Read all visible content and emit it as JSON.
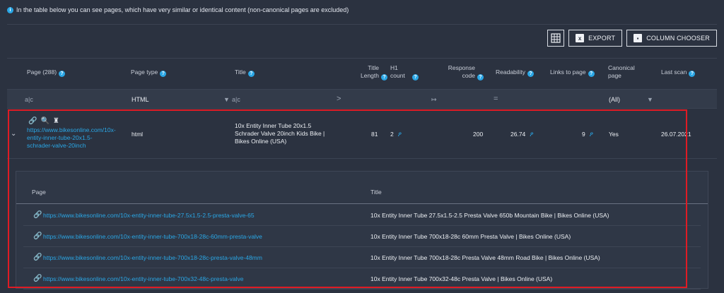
{
  "info": {
    "icon": "info-icon",
    "text": "In the table below you can see pages, which have very similar or identical content (non-canonical pages are excluded)"
  },
  "toolbar": {
    "grid_icon": "grid-settings-icon",
    "export_label": "EXPORT",
    "column_chooser_label": "COLUMN CHOOSER"
  },
  "columns": {
    "page": "Page (288)",
    "page_type": "Page type",
    "title": "Title",
    "title_length": "Title Length",
    "h1_count": "H1 count",
    "response_code": "Response code",
    "readability": "Readability",
    "links_to_page": "Links to page",
    "canonical": "Canonical page",
    "last_scan": "Last scan"
  },
  "filters": {
    "page": "a|c",
    "page_type": "HTML",
    "title": "a|c",
    "title_length": ">",
    "response_code": "↦",
    "readability": "=",
    "canonical": "(All)"
  },
  "row": {
    "url": "https://www.bikesonline.com/10x-entity-inner-tube-20x1.5-schrader-valve-20inch",
    "url_line1": "https://www.bikesonline.com/10x-",
    "url_line2": "entity-inner-tube-20x1.5-",
    "url_line3": "schrader-valve-20inch",
    "page_type": "html",
    "title_line1": "10x Entity Inner Tube 20x1.5",
    "title_line2": "Schrader Valve 20inch Kids Bike |",
    "title_line3": "Bikes Online (USA)",
    "title_length": "81",
    "h1_count": "2",
    "response_code": "200",
    "readability": "26.74",
    "links_to_page": "9",
    "canonical": "Yes",
    "last_scan": "26.07.2021"
  },
  "detail": {
    "col_page": "Page",
    "col_title": "Title",
    "rows": [
      {
        "page": "https://www.bikesonline.com/10x-entity-inner-tube-27.5x1.5-2.5-presta-valve-65",
        "title": "10x Entity Inner Tube 27.5x1.5-2.5 Presta Valve 650b Mountain Bike | Bikes Online (USA)"
      },
      {
        "page": "https://www.bikesonline.com/10x-entity-inner-tube-700x18-28c-60mm-presta-valve",
        "title": "10x Entity Inner Tube 700x18-28c 60mm Presta Valve | Bikes Online (USA)"
      },
      {
        "page": "https://www.bikesonline.com/10x-entity-inner-tube-700x18-28c-presta-valve-48mm",
        "title": "10x Entity Inner Tube 700x18-28c Presta Valve 48mm Road Bike | Bikes Online (USA)"
      },
      {
        "page": "https://www.bikesonline.com/10x-entity-inner-tube-700x32-48c-presta-valve",
        "title": "10x Entity Inner Tube 700x32-48c Presta Valve | Bikes Online (USA)"
      }
    ]
  },
  "colors": {
    "background": "#2b3240",
    "accent": "#2aa7e6",
    "highlight": "#e01b24"
  }
}
